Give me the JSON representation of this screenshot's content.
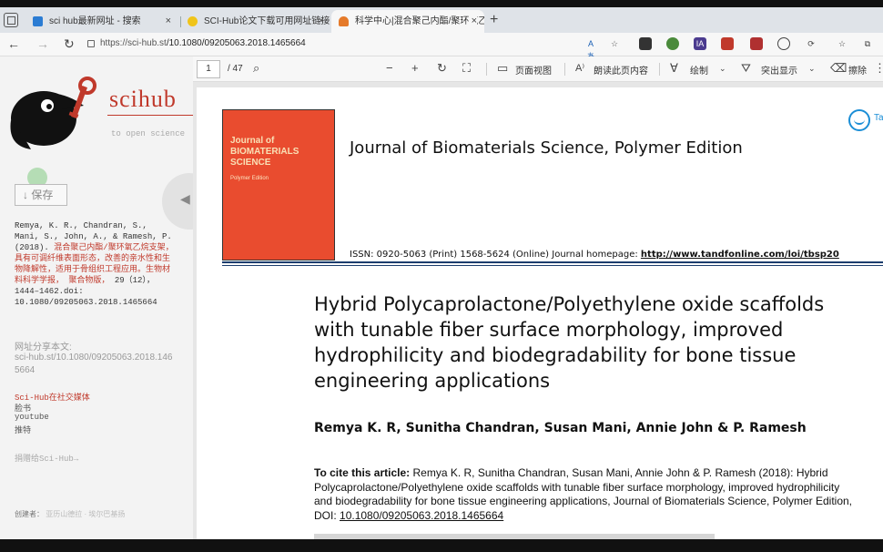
{
  "browser": {
    "tabs": [
      {
        "label": "sci hub最新网址 - 搜索",
        "color": "#2b7cd3"
      },
      {
        "label": "SCI-Hub论文下载可用网址链接",
        "color": "#f0c419"
      },
      {
        "label": "科学中心|混合聚己内酯/聚环氧乙",
        "color": "#e57a2a"
      }
    ],
    "close_glyph": "×",
    "new_tab_glyph": "+",
    "url_host": "https://sci-hub.st",
    "url_path": "/10.1080/09205063.2018.1465664",
    "back_icon": "arrow-left-icon",
    "reload_icon": "reload-icon"
  },
  "pdf_toolbar": {
    "page_current": "1",
    "page_total": "/ 47",
    "page_view": "页面视图",
    "read_aloud": "朗读此页内容",
    "draw": "绘制",
    "highlight": "突出显示",
    "erase": "擦除"
  },
  "sidebar": {
    "logo": "scihub",
    "tagline": "to open science",
    "save": "↓ 保存",
    "citation_plain": "Remya, K. R., Chandran, S., Mani, S., John, A., & Ramesh, P. (2018).",
    "citation_title": "混合聚己内酯/聚环氧乙烷支架，具有可调纤维表面形态，改善的亲水性和生物降解性，适用于骨组织工程应用。生物材料科学学报， 聚合物版，",
    "citation_tail": "29（12）， 1444–1462.doi: 10.1080/09205063.2018.1465664",
    "share_label": "网址分享本文:",
    "share_link": "sci-hub.st/10.1080/09205063.2018.1465664",
    "social_head": "Sci-Hub在社交媒体",
    "social": [
      "脸书",
      "youtube",
      "推特"
    ],
    "donate": "捐赠给Sci-Hub→",
    "creator_label": "创建者：",
    "creator_name": "亚历山德拉 · 埃尔巴基扬"
  },
  "pdf": {
    "cover_title": "Journal of BIOMATERIALS SCIENCE",
    "cover_sub": "Polymer Edition",
    "publisher": "Ta",
    "journal": "Journal of Biomaterials Science, Polymer Edition",
    "issn": "ISSN: 0920-5063 (Print) 1568-5624 (Online) Journal homepage:",
    "homepage": "http://www.tandfonline.com/loi/tbsp20",
    "title": "Hybrid Polycaprolactone/Polyethylene oxide scaffolds with tunable fiber surface morphology, improved hydrophilicity and biodegradability for bone tissue engineering applications",
    "authors": "Remya K. R, Sunitha Chandran, Susan Mani, Annie John & P. Ramesh",
    "cite_label": "To cite this article:",
    "cite_text": "Remya K. R, Sunitha Chandran, Susan Mani, Annie John & P. Ramesh (2018): Hybrid Polycaprolactone/Polyethylene oxide scaffolds with tunable fiber surface morphology, improved hydrophilicity and biodegradability for bone tissue engineering applications, Journal of Biomaterials Science, Polymer Edition, DOI:",
    "cite_doi": "10.1080/09205063.2018.1465664"
  }
}
